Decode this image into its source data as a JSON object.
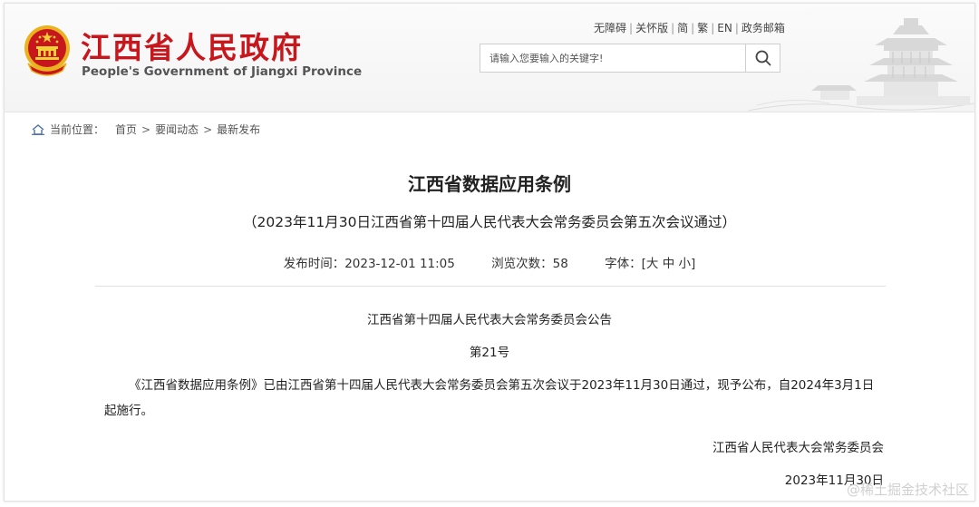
{
  "header": {
    "title": "江西省人民政府",
    "subtitle": "People's Government of Jiangxi Province",
    "toplinks": [
      "无障碍",
      "关怀版",
      "简",
      "繁",
      "EN",
      "政务邮箱"
    ],
    "search_placeholder": "请输入您要输入的关键字!"
  },
  "breadcrumb": {
    "label": "当前位置：",
    "items": [
      "首页",
      "要闻动态",
      "最新发布"
    ]
  },
  "article": {
    "title": "江西省数据应用条例",
    "subtitle": "（2023年11月30日江西省第十四届人民代表大会常务委员会第五次会议通过）",
    "publish_label": "发布时间：",
    "publish_time": "2023-12-01 11:05",
    "views_label": "浏览次数：",
    "views": "58",
    "font_label": "字体：",
    "font_sizes": [
      "大",
      "中",
      "小"
    ],
    "announcement": "江西省第十四届人民代表大会常务委员会公告",
    "number": "第21号",
    "body": "《江西省数据应用条例》已由江西省第十四届人民代表大会常务委员会第五次会议于2023年11月30日通过，现予公布，自2024年3月1日起施行。",
    "issuer": "江西省人民代表大会常务委员会",
    "date": "2023年11月30日"
  },
  "watermark": "@稀土掘金技术社区",
  "colors": {
    "brand_red": "#c8161d",
    "emblem_gold": "#e9b21e"
  }
}
